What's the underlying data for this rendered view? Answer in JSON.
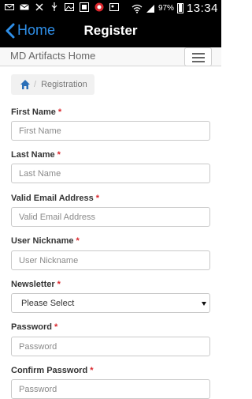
{
  "status_bar": {
    "battery_percent": "97%",
    "clock": "13:34"
  },
  "nav": {
    "back_label": "Home",
    "title": "Register"
  },
  "site": {
    "brand": "MD Artifacts Home"
  },
  "breadcrumb": {
    "separator": "/",
    "current": "Registration"
  },
  "form": {
    "required_mark": "*",
    "first_name": {
      "label": "First Name",
      "placeholder": "First Name"
    },
    "last_name": {
      "label": "Last Name",
      "placeholder": "Last Name"
    },
    "email": {
      "label": "Valid Email Address",
      "placeholder": "Valid Email Address"
    },
    "nickname": {
      "label": "User Nickname",
      "placeholder": "User Nickname"
    },
    "newsletter": {
      "label": "Newsletter",
      "selected": "Please Select"
    },
    "password": {
      "label": "Password",
      "placeholder": "Password"
    },
    "confirm_password": {
      "label": "Confirm Password",
      "placeholder": "Password"
    }
  },
  "colors": {
    "accent": "#2f8fe8",
    "required": "#d9262c"
  }
}
